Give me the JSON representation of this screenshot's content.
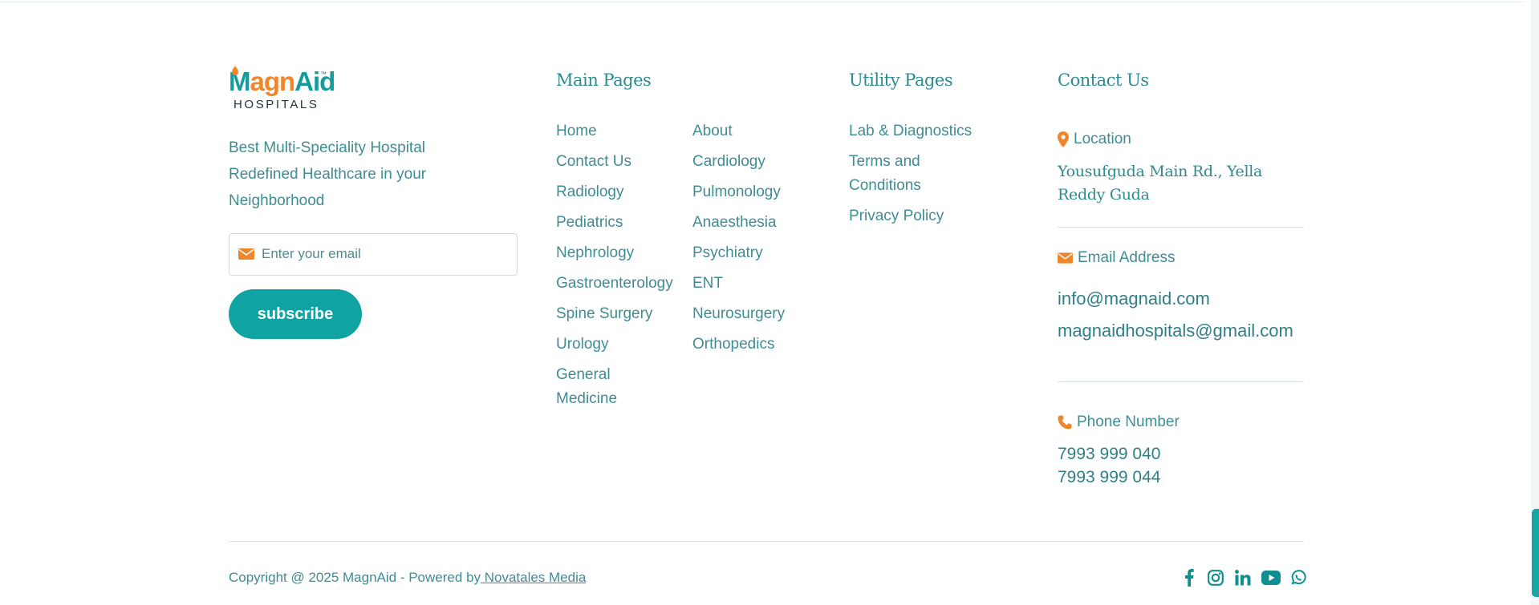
{
  "brand": {
    "logo_text_part1": "M",
    "logo_text_part2": "agn",
    "logo_text_part3": "Aid",
    "logo_trademark": "™",
    "logo_subtitle": "HOSPITALS",
    "tagline": "Best Multi-Speciality Hospital Redefined Healthcare in your Neighborhood"
  },
  "newsletter": {
    "placeholder": "Enter your email",
    "subscribe_label": "subscribe"
  },
  "main_pages": {
    "heading": "Main Pages",
    "col1": [
      "Home",
      "Contact Us",
      "Radiology",
      "Pediatrics",
      "Nephrology",
      "Gastroenterology",
      "Spine Surgery",
      "Urology",
      "General Medicine"
    ],
    "col2": [
      "About",
      "Cardiology",
      "Pulmonology",
      "Anaesthesia",
      "Psychiatry",
      "ENT",
      "Neurosurgery",
      "Orthopedics"
    ]
  },
  "utility_pages": {
    "heading": "Utility Pages",
    "items": [
      "Lab & Diagnostics",
      "Terms and Conditions",
      "Privacy Policy"
    ]
  },
  "contact": {
    "heading": "Contact Us",
    "location_label": "Location",
    "address": "Yousufguda Main Rd., Yella Reddy Guda",
    "email_label": "Email Address",
    "emails": [
      "info@magnaid.com",
      "magnaidhospitals@gmail.com"
    ],
    "phone_label": "Phone Number",
    "phones": [
      "7993 999 040",
      "7993 999 044"
    ]
  },
  "footer": {
    "copyright_text": "Copyright @ 2025 MagnAid - Powered by",
    "powered_by_link": " Novatales Media"
  },
  "social": [
    "facebook-icon",
    "instagram-icon",
    "linkedin-icon",
    "youtube-icon",
    "whatsapp-icon"
  ],
  "colors": {
    "teal": "#0fa3a3",
    "text": "#3f8c92",
    "accent": "#f0862c"
  }
}
